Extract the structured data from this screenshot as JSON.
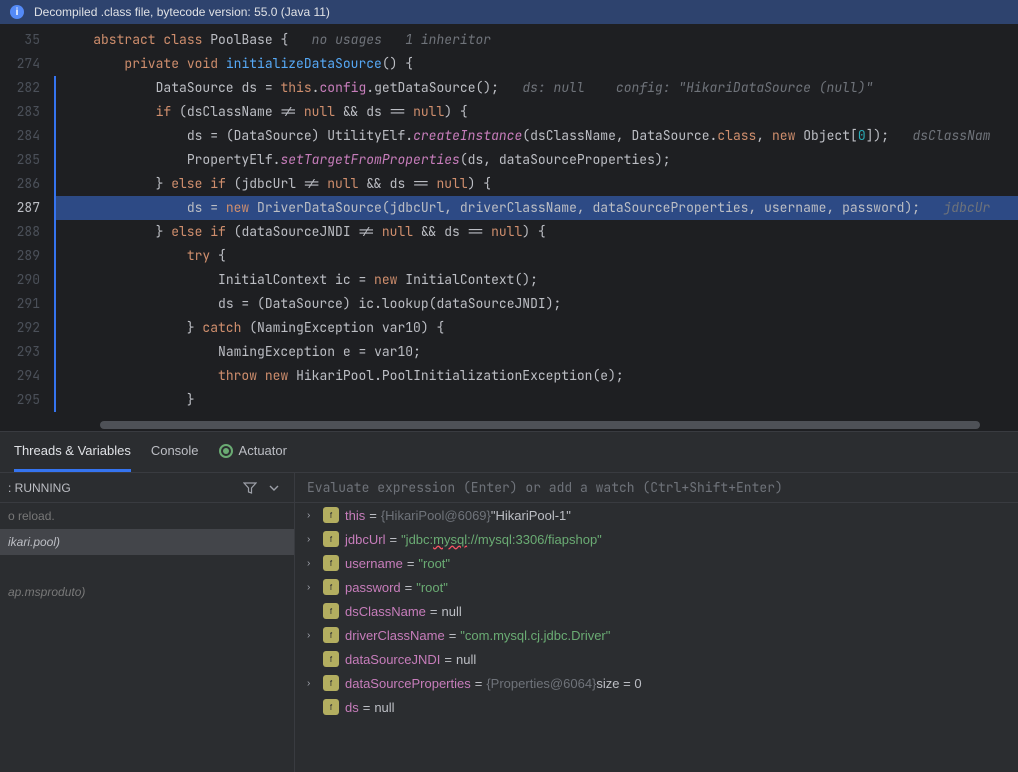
{
  "banner": {
    "text": "Decompiled .class file, bytecode version: 55.0 (Java 11)"
  },
  "gutter": {
    "lines": [
      "35",
      "274",
      "282",
      "283",
      "284",
      "285",
      "286",
      "287",
      "288",
      "289",
      "290",
      "291",
      "292",
      "293",
      "294",
      "295"
    ],
    "current": "287"
  },
  "code": {
    "hints": {
      "usages": "no usages",
      "inheritor": "1 inheritor"
    },
    "l35_abstract": "abstract",
    "l35_class": "class",
    "l35_name": "PoolBase",
    "l274_private": "private",
    "l274_void": "void",
    "l274_method": "initializeDataSource",
    "l282_type": "DataSource",
    "l282_var": "ds",
    "l282_this": "this",
    "l282_config": "config",
    "l282_call": "getDataSource",
    "l282_hint": "ds: null    config: \"HikariDataSource (null)\"",
    "l283_if": "if",
    "l283_var1": "dsClassName",
    "l283_null": "null",
    "l283_var2": "ds",
    "l284_var": "ds",
    "l284_cast": "DataSource",
    "l284_cls": "UtilityElf",
    "l284_method": "createInstance",
    "l284_arg1": "dsClassName",
    "l284_arg2": "DataSource",
    "l284_class": "class",
    "l284_new": "new",
    "l284_obj": "Object",
    "l284_zero": "0",
    "l284_hint": "dsClassNam",
    "l285_cls": "PropertyElf",
    "l285_method": "setTargetFromProperties",
    "l285_arg1": "ds",
    "l285_arg2": "dataSourceProperties",
    "l286_else": "else",
    "l286_if": "if",
    "l286_var1": "jdbcUrl",
    "l286_null": "null",
    "l286_var2": "ds",
    "l287_var": "ds",
    "l287_new": "new",
    "l287_cls": "DriverDataSource",
    "l287_args": "jdbcUrl, driverClassName, dataSourceProperties, username, password",
    "l287_hint": "jdbcUr",
    "l288_else": "else",
    "l288_if": "if",
    "l288_var1": "dataSourceJNDI",
    "l288_null": "null",
    "l288_var2": "ds",
    "l289_try": "try",
    "l290_type": "InitialContext",
    "l290_var": "ic",
    "l290_new": "new",
    "l291_var": "ds",
    "l291_cast": "DataSource",
    "l291_obj": "ic",
    "l291_call": "lookup",
    "l291_arg": "dataSourceJNDI",
    "l292_catch": "catch",
    "l292_type": "NamingException",
    "l292_var": "var10",
    "l293_type": "NamingException",
    "l293_var": "e",
    "l293_val": "var10",
    "l294_throw": "throw",
    "l294_new": "new",
    "l294_cls": "HikariPool.PoolInitializationException",
    "l294_arg": "e"
  },
  "debug": {
    "tabs": {
      "threads": "Threads & Variables",
      "console": "Console",
      "actuator": "Actuator"
    },
    "frames": {
      "status": ": RUNNING",
      "reload": "o reload.",
      "item1_pkg": "ikari.pool)",
      "item2_pkg": "ap.msproduto)"
    },
    "watch_placeholder": "Evaluate expression (Enter) or add a watch (Ctrl+Shift+Enter)",
    "vars": [
      {
        "name": "this",
        "gray": "{HikariPool@6069}",
        "str": "\"HikariPool-1\"",
        "expand": true
      },
      {
        "name": "jdbcUrl",
        "str_pre": "\"jdbc:",
        "str_mid": "mysql",
        "str_post": "://mysql:3306/fiapshop\"",
        "expand": true
      },
      {
        "name": "username",
        "str": "\"root\"",
        "expand": true
      },
      {
        "name": "password",
        "str": "\"root\"",
        "expand": true
      },
      {
        "name": "dsClassName",
        "val": "null",
        "expand": false
      },
      {
        "name": "driverClassName",
        "str": "\"com.mysql.cj.jdbc.Driver\"",
        "expand": true
      },
      {
        "name": "dataSourceJNDI",
        "val": "null",
        "expand": false
      },
      {
        "name": "dataSourceProperties",
        "gray": "{Properties@6064}",
        "plain": "  size = 0",
        "expand": true
      },
      {
        "name": "ds",
        "val": "null",
        "expand": false
      }
    ]
  }
}
